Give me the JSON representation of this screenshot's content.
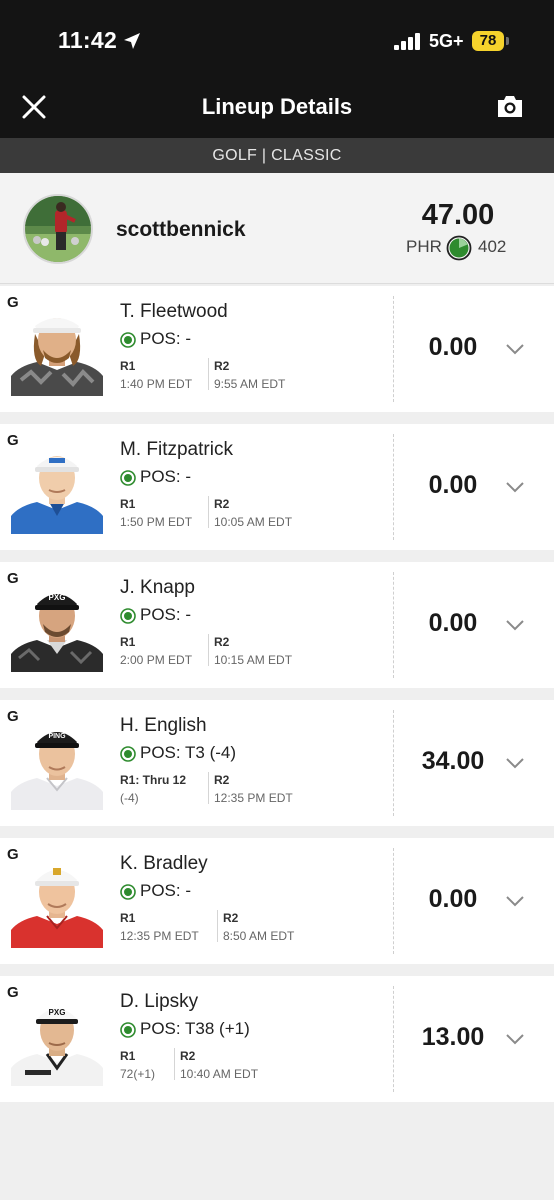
{
  "status": {
    "time": "11:42",
    "network": "5G+",
    "battery": "78"
  },
  "nav": {
    "title": "Lineup Details"
  },
  "subheader": "GOLF | CLASSIC",
  "user": {
    "name": "scottbennick",
    "total": "47.00",
    "phr_label": "PHR",
    "phr_value": "402"
  },
  "players": [
    {
      "tag": "G",
      "name": "T. Fleetwood",
      "pos": "POS: -",
      "r1_label": "R1",
      "r1_value": "1:40 PM EDT",
      "r2_label": "R2",
      "r2_value": "9:55 AM EDT",
      "score": "0.00"
    },
    {
      "tag": "G",
      "name": "M. Fitzpatrick",
      "pos": "POS: -",
      "r1_label": "R1",
      "r1_value": "1:50 PM EDT",
      "r2_label": "R2",
      "r2_value": "10:05 AM EDT",
      "score": "0.00"
    },
    {
      "tag": "G",
      "name": "J. Knapp",
      "pos": "POS: -",
      "r1_label": "R1",
      "r1_value": "2:00 PM EDT",
      "r2_label": "R2",
      "r2_value": "10:15 AM EDT",
      "score": "0.00"
    },
    {
      "tag": "G",
      "name": "H. English",
      "pos": "POS: T3 (-4)",
      "r1_label": "R1: Thru 12",
      "r1_value": "(-4)",
      "r2_label": "R2",
      "r2_value": "12:35 PM EDT",
      "score": "34.00"
    },
    {
      "tag": "G",
      "name": "K. Bradley",
      "pos": "POS: -",
      "r1_label": "R1",
      "r1_value": "12:35 PM EDT",
      "r2_label": "R2",
      "r2_value": "8:50 AM EDT",
      "score": "0.00"
    },
    {
      "tag": "G",
      "name": "D. Lipsky",
      "pos": "POS: T38 (+1)",
      "r1_label": "R1",
      "r1_value": "72(+1)",
      "r2_label": "R2",
      "r2_value": "10:40 AM EDT",
      "score": "13.00"
    }
  ],
  "colors": {
    "status_green": "#2e8b2e",
    "battery_yellow": "#f5d22c",
    "header_dark": "#141414",
    "subheader_gray": "#3a3a3a"
  },
  "icons": [
    "location-arrow-icon",
    "signal-icon",
    "close-icon",
    "camera-icon",
    "phr-clock-icon",
    "status-dot-icon",
    "chevron-down-icon"
  ]
}
